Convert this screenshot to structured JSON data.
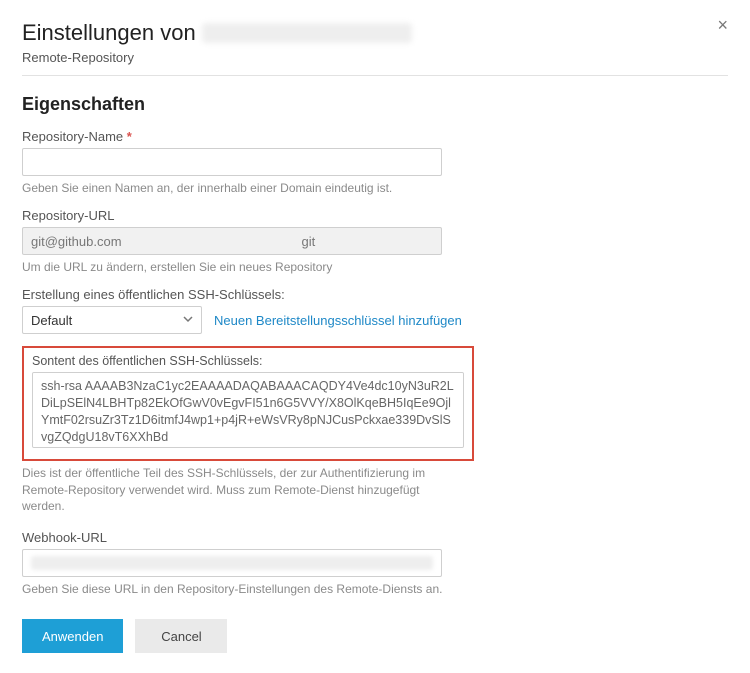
{
  "header": {
    "title_prefix": "Einstellungen von",
    "subtitle": "Remote-Repository"
  },
  "section": {
    "heading": "Eigenschaften"
  },
  "fields": {
    "repo_name": {
      "label": "Repository-Name",
      "required_mark": "*",
      "value": "",
      "helper": "Geben Sie einen Namen an, der innerhalb einer Domain eindeutig ist."
    },
    "repo_url": {
      "label": "Repository-URL",
      "value_left": "git@github.com",
      "value_right": "git",
      "helper": "Um die URL zu ändern, erstellen Sie ein neues Repository"
    },
    "ssh_select": {
      "label": "Erstellung eines öffentlichen SSH-Schlüssels:",
      "selected": "Default",
      "link": "Neuen Bereitstellungsschlüssel hinzufügen"
    },
    "ssh_content": {
      "label": "Sontent des öffentlichen SSH-Schlüssels:",
      "value": "ssh-rsa AAAAB3NzaC1yc2EAAAADAQABAAACAQDY4Ve4dc10yN3uR2LDiLpSElN4LBHTp82EkOfGwV0vEgvFI51n6G5VVY/X8OlKqeBH5IqEe9OjlYmtF02rsuZr3Tz1D6itmfJ4wp1+p4jR+eWsVRy8pNJCusPckxae339DvSlSvgZQdgU18vT6XXhBd",
      "helper": "Dies ist der öffentliche Teil des SSH-Schlüssels, der zur Authentifizierung im Remote-Repository verwendet wird. Muss zum Remote-Dienst hinzugefügt werden."
    },
    "webhook": {
      "label": "Webhook-URL",
      "helper": "Geben Sie diese URL in den Repository-Einstellungen des Remote-Diensts an."
    }
  },
  "actions": {
    "apply": "Anwenden",
    "cancel": "Cancel"
  }
}
